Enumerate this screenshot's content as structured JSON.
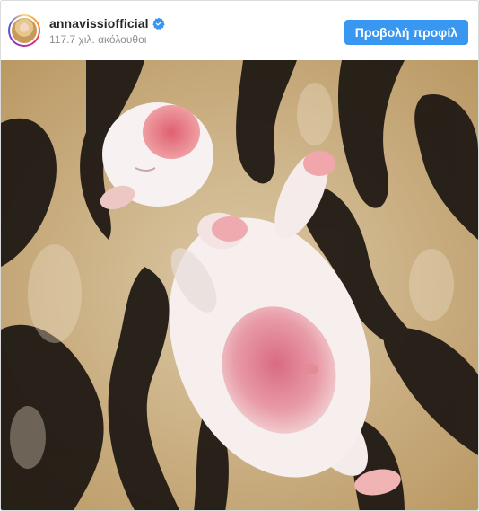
{
  "post": {
    "username": "annavissiofficial",
    "verified": true,
    "followers": "117.7 χιλ. ακόλουθοι",
    "view_profile_label": "Προβολή προφίλ",
    "accent_color": "#3897f0",
    "photo_subject": "newborn-puppy-on-zebra-blanket"
  }
}
